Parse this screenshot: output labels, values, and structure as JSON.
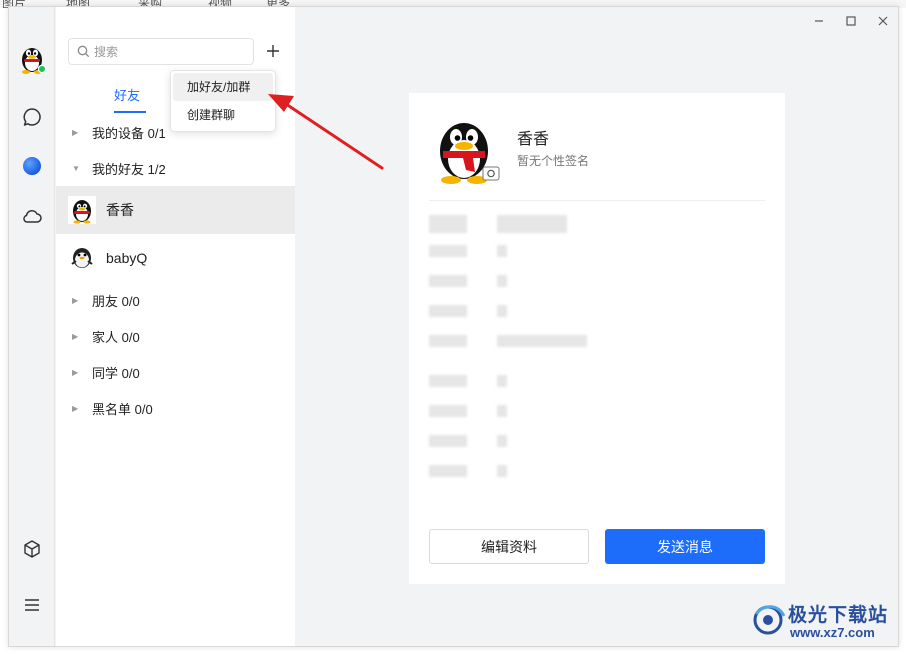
{
  "background": {
    "top_tabs": [
      "图片",
      "地图",
      "采购",
      "视频",
      "更多"
    ]
  },
  "window_controls": {
    "minimize": "—",
    "maximize": "☐",
    "close": "✕"
  },
  "search": {
    "placeholder": "搜索"
  },
  "tabs": {
    "friends": "好友"
  },
  "dropdown_menu": {
    "add_friend_group": "加好友/加群",
    "create_group_chat": "创建群聊"
  },
  "contacts": {
    "groups": [
      {
        "label": "我的设备 0/1",
        "expanded": false
      },
      {
        "label": "我的好友 1/2",
        "expanded": true
      }
    ],
    "friends": [
      {
        "name": "香香",
        "selected": true
      },
      {
        "name": "babyQ",
        "selected": false
      }
    ],
    "other_groups": [
      "朋友 0/0",
      "家人 0/0",
      "同学 0/0",
      "黑名单 0/0"
    ]
  },
  "profile": {
    "name": "香香",
    "signature": "暂无个性签名",
    "edit_button": "编辑资料",
    "send_button": "发送消息"
  },
  "colors": {
    "accent": "#1e6cfa",
    "annotation_arrow": "#e02020",
    "watermark": "#2a4f9d"
  },
  "watermark": {
    "title": "极光下载站",
    "url": "www.xz7.com"
  }
}
